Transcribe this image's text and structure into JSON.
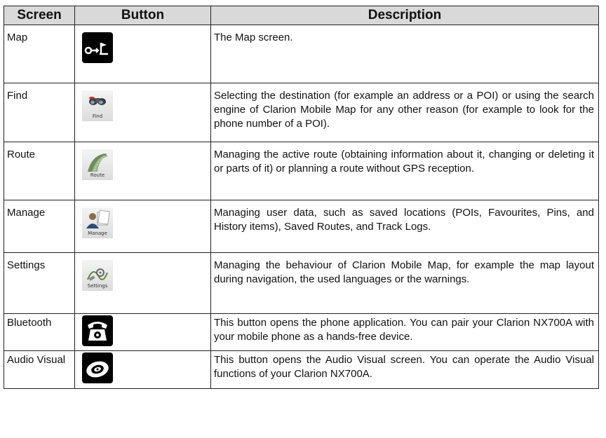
{
  "table": {
    "headers": {
      "screen": "Screen",
      "button": "Button",
      "description": "Description"
    },
    "rows": [
      {
        "screen": "Map",
        "icon": "map-flag-icon",
        "caption": "",
        "description": "The Map screen."
      },
      {
        "screen": "Find",
        "icon": "binoculars-icon",
        "caption": "Find",
        "description": "Selecting the destination (for example an address or a POI) or using the search engine of Clarion Mobile Map for any other reason (for example to look for the phone number of a POI)."
      },
      {
        "screen": "Route",
        "icon": "road-icon",
        "caption": "Route",
        "description": "Managing the active route (obtaining information about it, changing or deleting it or parts of it) or planning a route without GPS reception."
      },
      {
        "screen": "Manage",
        "icon": "user-data-icon",
        "caption": "Manage",
        "description": "Managing user data, such as saved locations (POIs, Favourites, Pins, and History items), Saved Routes, and Track Logs."
      },
      {
        "screen": "Settings",
        "icon": "settings-icon",
        "caption": "Settings",
        "description": "Managing the behaviour of Clarion Mobile Map, for example the map layout during navigation, the used languages or the warnings."
      },
      {
        "screen": "Bluetooth",
        "icon": "telephone-icon",
        "caption": "",
        "description": "This button opens the phone application. You can pair your Clarion NX700A with your mobile phone as a hands-free device."
      },
      {
        "screen": "Audio Visual",
        "icon": "disc-icon",
        "caption": "",
        "description": "This button opens the Audio Visual screen. You can operate the Audio Visual functions of your Clarion NX700A."
      }
    ]
  }
}
